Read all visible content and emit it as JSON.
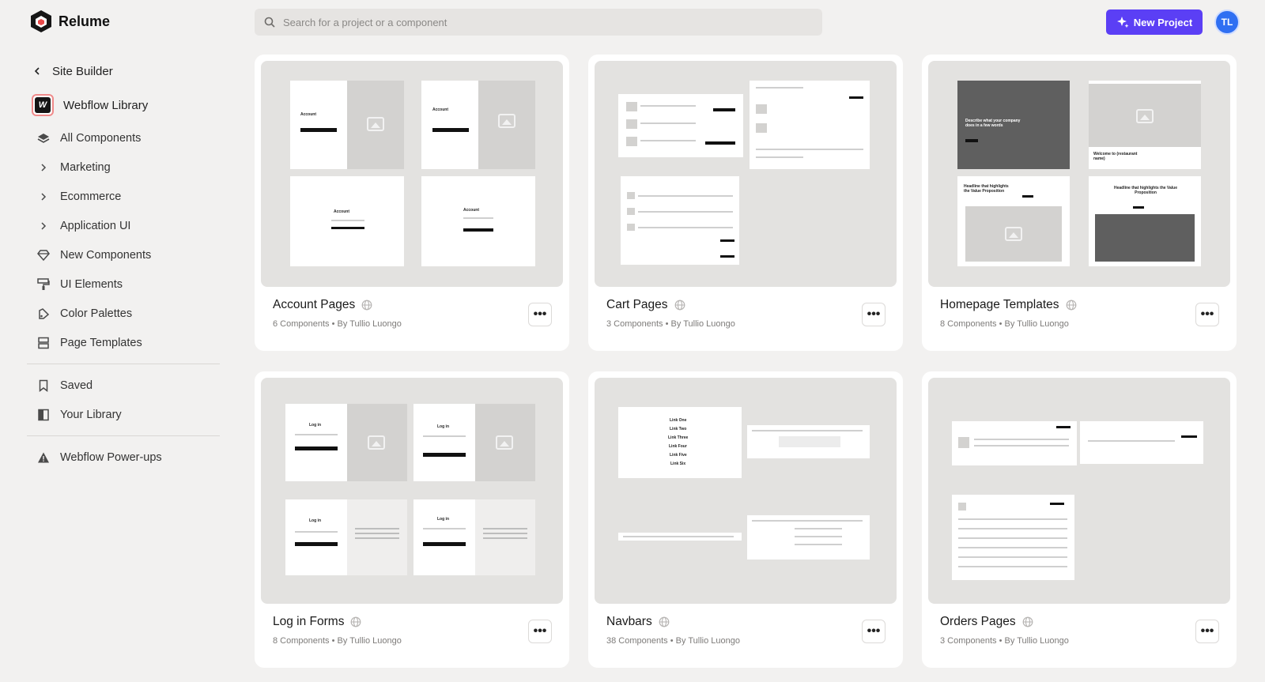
{
  "app": {
    "name": "Relume"
  },
  "search": {
    "placeholder": "Search for a project or a component"
  },
  "header": {
    "new_project_label": "New Project",
    "avatar_initials": "TL"
  },
  "sidebar": {
    "back_label": "Site Builder",
    "library_label": "Webflow Library",
    "items": [
      {
        "label": "All Components",
        "icon": "layers-icon"
      },
      {
        "label": "Marketing",
        "icon": "chevron-right-icon"
      },
      {
        "label": "Ecommerce",
        "icon": "chevron-right-icon"
      },
      {
        "label": "Application UI",
        "icon": "chevron-right-icon"
      },
      {
        "label": "New Components",
        "icon": "diamond-icon"
      },
      {
        "label": "UI Elements",
        "icon": "paint-roller-icon"
      },
      {
        "label": "Color Palettes",
        "icon": "palette-icon"
      },
      {
        "label": "Page Templates",
        "icon": "template-icon"
      }
    ],
    "secondary": [
      {
        "label": "Saved",
        "icon": "bookmark-icon"
      },
      {
        "label": "Your Library",
        "icon": "book-icon"
      }
    ],
    "footer": [
      {
        "label": "Webflow Power-ups",
        "icon": "warning-triangle-icon"
      }
    ]
  },
  "cards": [
    {
      "title": "Account Pages",
      "meta": "6 Components • By Tullio Luongo"
    },
    {
      "title": "Cart Pages",
      "meta": "3 Components • By Tullio Luongo"
    },
    {
      "title": "Homepage Templates",
      "meta": "8 Components • By Tullio Luongo"
    },
    {
      "title": "Log in Forms",
      "meta": "8 Components • By Tullio Luongo"
    },
    {
      "title": "Navbars",
      "meta": "38 Components • By Tullio Luongo"
    },
    {
      "title": "Orders Pages",
      "meta": "3 Components • By Tullio Luongo"
    }
  ],
  "previews": {
    "account": [
      "Account",
      "Account",
      "Account",
      "Account"
    ],
    "login": [
      "Log in",
      "Log in",
      "Log in",
      "Log in"
    ],
    "navbar_links": [
      "Link One",
      "Link Two",
      "Link Three",
      "Link Four",
      "Link Five",
      "Link Six"
    ],
    "homepage": [
      "Describe what your company does in a few words",
      "Welcome to (restaurant name)",
      "Headline that highlights the Value Proposition",
      "Headline that highlights the Value Proposition"
    ]
  },
  "colors": {
    "accent": "#5b3ff5",
    "avatar": "#2f6ff2",
    "background": "#f2f1f0"
  }
}
